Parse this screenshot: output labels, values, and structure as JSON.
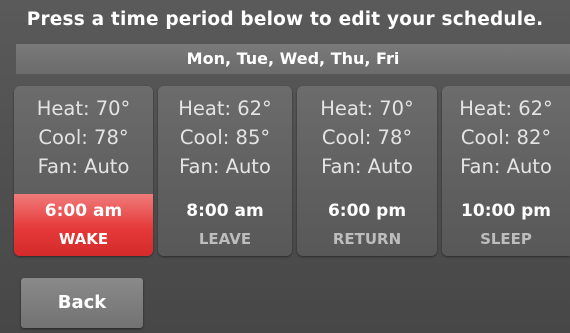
{
  "header": {
    "title": "Press a time period below to edit your schedule.",
    "days": "Mon, Tue, Wed, Thu, Fri"
  },
  "periods": [
    {
      "heat": "Heat: 70°",
      "cool": "Cool: 78°",
      "fan": "Fan: Auto",
      "time": "6:00 am",
      "name": "WAKE",
      "selected": true
    },
    {
      "heat": "Heat: 62°",
      "cool": "Cool: 85°",
      "fan": "Fan: Auto",
      "time": "8:00 am",
      "name": "LEAVE",
      "selected": false
    },
    {
      "heat": "Heat: 70°",
      "cool": "Cool: 78°",
      "fan": "Fan: Auto",
      "time": "6:00 pm",
      "name": "RETURN",
      "selected": false
    },
    {
      "heat": "Heat: 62°",
      "cool": "Cool: 82°",
      "fan": "Fan: Auto",
      "time": "10:00 pm",
      "name": "SLEEP",
      "selected": false
    }
  ],
  "footer": {
    "back_label": "Back"
  },
  "colors": {
    "background": "#4f4f4f",
    "tile": "#626262",
    "selected_accent": "#e63a3a",
    "text_primary": "#ffffff",
    "text_secondary": "#bdbdbd"
  }
}
